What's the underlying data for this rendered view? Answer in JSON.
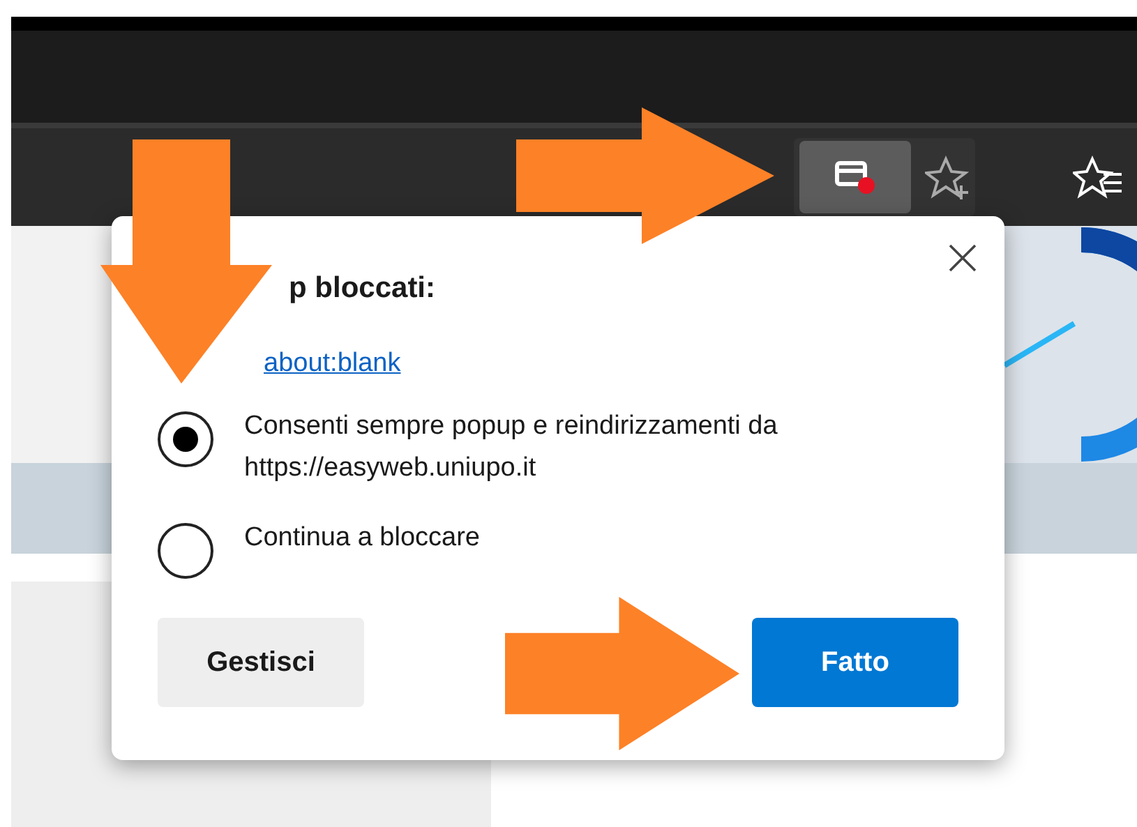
{
  "dialog": {
    "title": "p bloccati:",
    "blocked_link": "about:blank",
    "options": [
      {
        "label": "Consenti sempre popup e reindirizzamenti da https://easyweb.uniupo.it",
        "selected": true
      },
      {
        "label": "Continua a bloccare",
        "selected": false
      }
    ],
    "manage_button": "Gestisci",
    "done_button": "Fatto"
  }
}
